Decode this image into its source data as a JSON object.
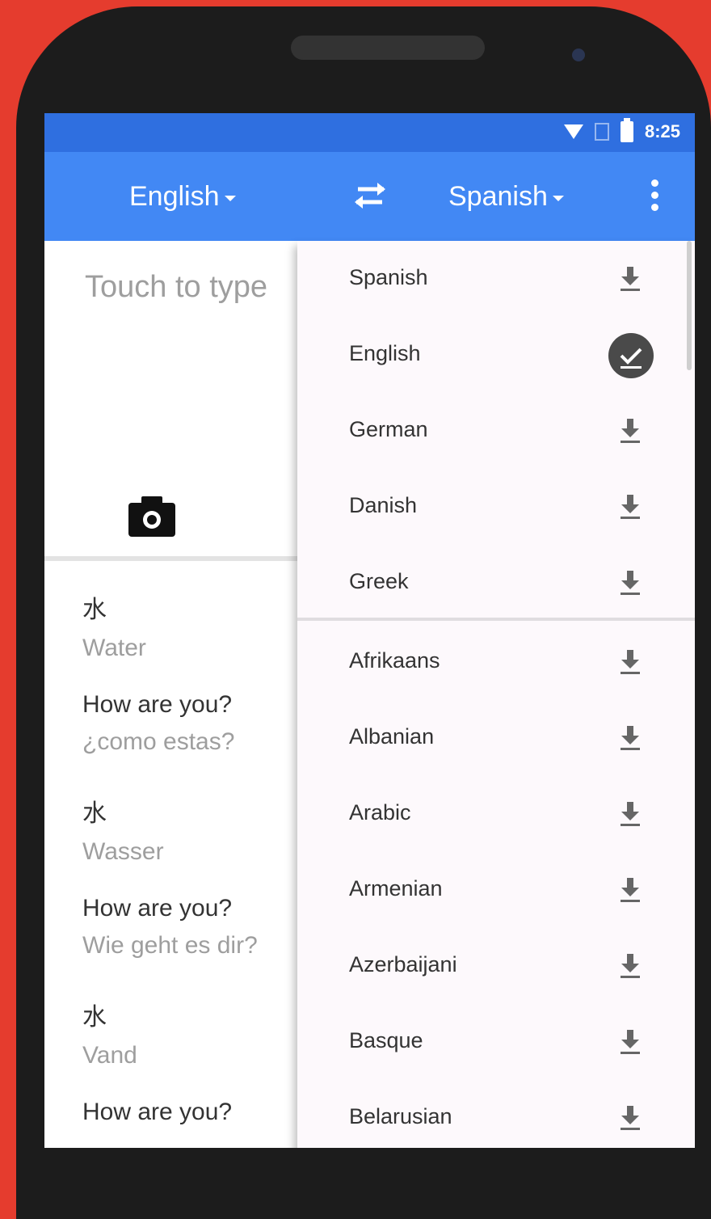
{
  "status_bar": {
    "time": "8:25"
  },
  "toolbar": {
    "source_language": "English",
    "target_language": "Spanish"
  },
  "input": {
    "placeholder": "Touch to type"
  },
  "history": [
    {
      "source": "水",
      "translation": "Water"
    },
    {
      "source": "How are you?",
      "translation": "¿como estas?"
    },
    {
      "source": "水",
      "translation": "Wasser"
    },
    {
      "source": "How are you?",
      "translation": "Wie geht es dir?"
    },
    {
      "source": "水",
      "translation": "Vand"
    },
    {
      "source": "How are you?",
      "translation": ""
    }
  ],
  "language_menu": {
    "recent": [
      {
        "label": "Spanish",
        "status": "download"
      },
      {
        "label": "English",
        "status": "downloaded"
      },
      {
        "label": "German",
        "status": "download"
      },
      {
        "label": "Danish",
        "status": "download"
      },
      {
        "label": "Greek",
        "status": "download"
      }
    ],
    "all": [
      {
        "label": "Afrikaans",
        "status": "download"
      },
      {
        "label": "Albanian",
        "status": "download"
      },
      {
        "label": "Arabic",
        "status": "download"
      },
      {
        "label": "Armenian",
        "status": "download"
      },
      {
        "label": "Azerbaijani",
        "status": "download"
      },
      {
        "label": "Basque",
        "status": "download"
      },
      {
        "label": "Belarusian",
        "status": "download"
      }
    ]
  },
  "colors": {
    "background": "#e53c2e",
    "status_bar": "#2f6fe0",
    "toolbar": "#4288f4"
  }
}
